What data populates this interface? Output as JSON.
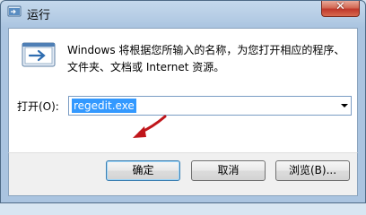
{
  "window": {
    "title": "运行"
  },
  "icons": {
    "app": "run-icon",
    "close": "close-icon",
    "main": "run-icon",
    "dropdown": "chevron-down-icon"
  },
  "description": {
    "line1": "Windows 将根据您所输入的名称，为您打开相应的程序、",
    "line2": "文件夹、文档或 Internet 资源。"
  },
  "open": {
    "label": "打开(O):",
    "value": "regedit.exe"
  },
  "buttons": {
    "ok": "确定",
    "cancel": "取消",
    "browse": "浏览(B)..."
  },
  "colors": {
    "selection": "#3399ff",
    "annotation_arrow": "#c0161b",
    "close_button": "#c0392b"
  }
}
